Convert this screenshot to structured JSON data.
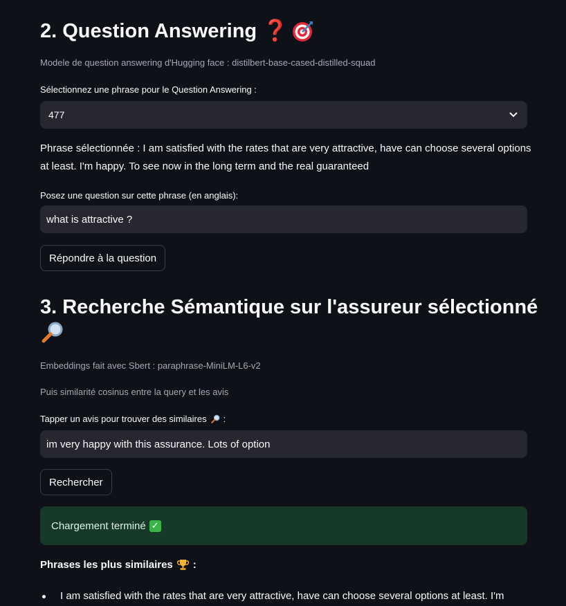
{
  "qa": {
    "title": "2. Question Answering",
    "title_emoji_question": "❓",
    "model_caption": "Modele de question answering d'Hugging face : distilbert-base-cased-distilled-squad",
    "select_label": "Sélectionnez une phrase pour le Question Answering :",
    "select_value": "477",
    "selected_sentence": "Phrase sélectionnée : I am satisfied with the rates that are very attractive, have can choose several options at least. I'm happy. To see now in the long term and the real guaranteed",
    "question_label": "Posez une question sur cette phrase (en anglais):",
    "question_value": "what is attractive ?",
    "answer_button": "Répondre à la question"
  },
  "semantic": {
    "title": "3. Recherche Sémantique sur l'assureur sélectionné",
    "caption_embeddings": "Embeddings fait avec Sbert : paraphrase-MiniLM-L6-v2",
    "caption_similarity": "Puis similarité cosinus entre la query et les avis",
    "input_label": "Tapper un avis pour trouver des similaires",
    "input_label_suffix": ":",
    "input_value": "im very happy with this assurance. Lots of option",
    "search_button": "Rechercher",
    "status": "Chargement terminé",
    "results_heading": "Phrases les plus similaires",
    "results_heading_suffix": ":",
    "results": [
      "I am satisfied with the rates that are very attractive, have can choose several options at least. I'm"
    ]
  },
  "colors": {
    "background": "#0e1117",
    "input_bg": "#262730",
    "success_bg": "#173928",
    "check": "#3bb54a"
  },
  "icons": [
    "question-mark-icon",
    "target-icon",
    "magnifier-icon",
    "check-icon",
    "trophy-icon",
    "chevron-down-icon"
  ]
}
